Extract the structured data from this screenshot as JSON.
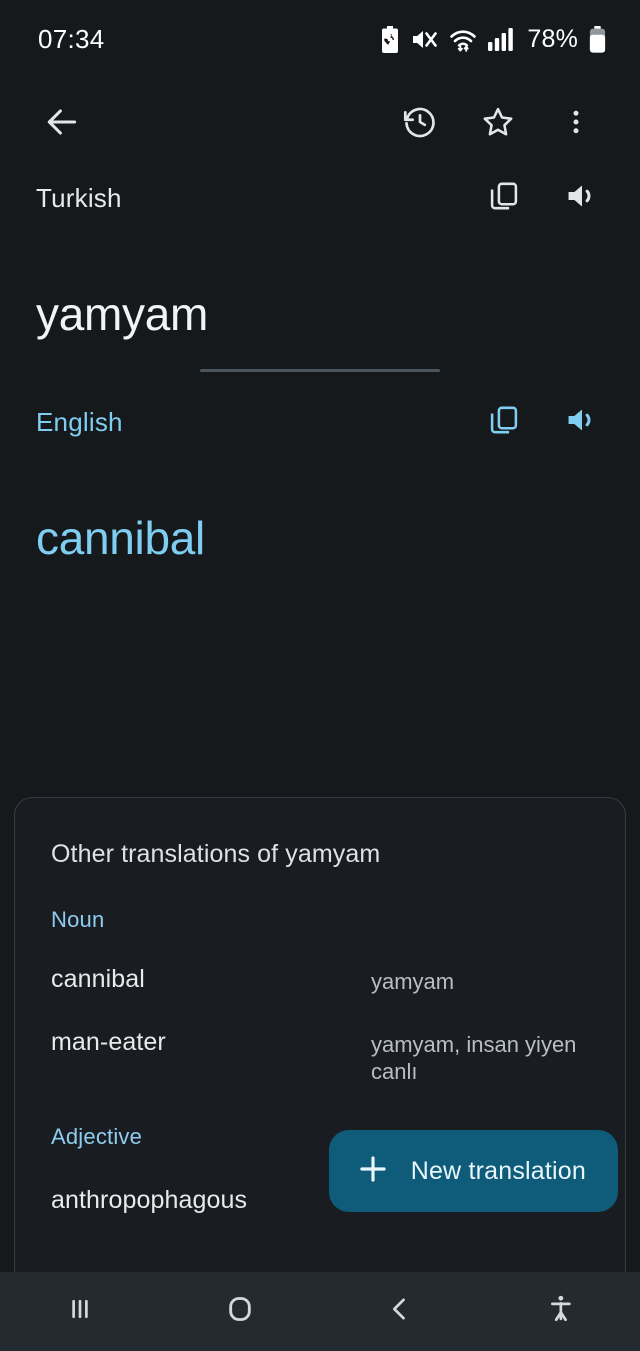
{
  "status_bar": {
    "time": "07:34",
    "battery_percent": "78%",
    "icons": [
      "battery-saver-icon",
      "volume-mute-icon",
      "wifi-icon",
      "cellular-signal-icon",
      "battery-icon"
    ]
  },
  "app_bar": {
    "back_label": "back-arrow",
    "history_label": "history",
    "favorite_label": "favorite",
    "overflow_label": "more-options"
  },
  "source": {
    "language": "Turkish",
    "text": "yamyam",
    "copy_label": "copy",
    "speak_label": "listen"
  },
  "target": {
    "language": "English",
    "text": "cannibal",
    "copy_label": "copy",
    "speak_label": "listen"
  },
  "other_translations": {
    "title": "Other translations of yamyam",
    "sections": [
      {
        "part_of_speech": "Noun",
        "rows": [
          {
            "word": "cannibal",
            "back_translations": "yamyam"
          },
          {
            "word": "man-eater",
            "back_translations": "yamyam, insan yiyen canlı"
          }
        ]
      },
      {
        "part_of_speech": "Adjective",
        "rows": [
          {
            "word": "anthropophagous",
            "back_translations": ""
          }
        ]
      }
    ]
  },
  "fab": {
    "label": "New translation",
    "icon": "plus-icon"
  },
  "nav_bar": {
    "recents_label": "recents",
    "home_label": "home",
    "back_label": "back",
    "accessibility_label": "accessibility"
  },
  "colors": {
    "page_background": "#16191c",
    "card_background": "#191d21",
    "accent_blue": "#7fcdf0",
    "fab_background": "#0e5c7a",
    "nav_background": "#232a30",
    "primary_text": "#f1f3f4"
  }
}
